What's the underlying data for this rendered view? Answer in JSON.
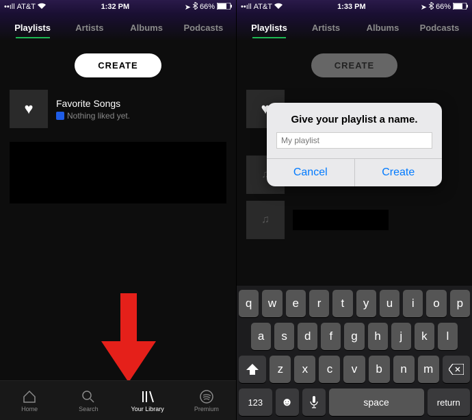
{
  "left": {
    "status": {
      "carrier": "AT&T",
      "time": "1:32 PM",
      "battery": "66%"
    },
    "tabs": [
      "Playlists",
      "Artists",
      "Albums",
      "Podcasts"
    ],
    "activeTab": 0,
    "createLabel": "CREATE",
    "favorite": {
      "title": "Favorite Songs",
      "subtitle": "Nothing liked yet."
    },
    "nav": {
      "home": "Home",
      "search": "Search",
      "library": "Your Library",
      "premium": "Premium"
    }
  },
  "right": {
    "status": {
      "carrier": "AT&T",
      "time": "1:33 PM",
      "battery": "66%"
    },
    "tabs": [
      "Playlists",
      "Artists",
      "Albums",
      "Podcasts"
    ],
    "activeTab": 0,
    "createLabel": "CREATE",
    "dialog": {
      "title": "Give your playlist a name.",
      "placeholder": "My playlist",
      "cancel": "Cancel",
      "create": "Create"
    },
    "keyboard": {
      "row1": [
        "q",
        "w",
        "e",
        "r",
        "t",
        "y",
        "u",
        "i",
        "o",
        "p"
      ],
      "row2": [
        "a",
        "s",
        "d",
        "f",
        "g",
        "h",
        "j",
        "k",
        "l"
      ],
      "row3": [
        "z",
        "x",
        "c",
        "v",
        "b",
        "n",
        "m"
      ],
      "mode": "123",
      "space": "space",
      "ret": "return"
    }
  }
}
